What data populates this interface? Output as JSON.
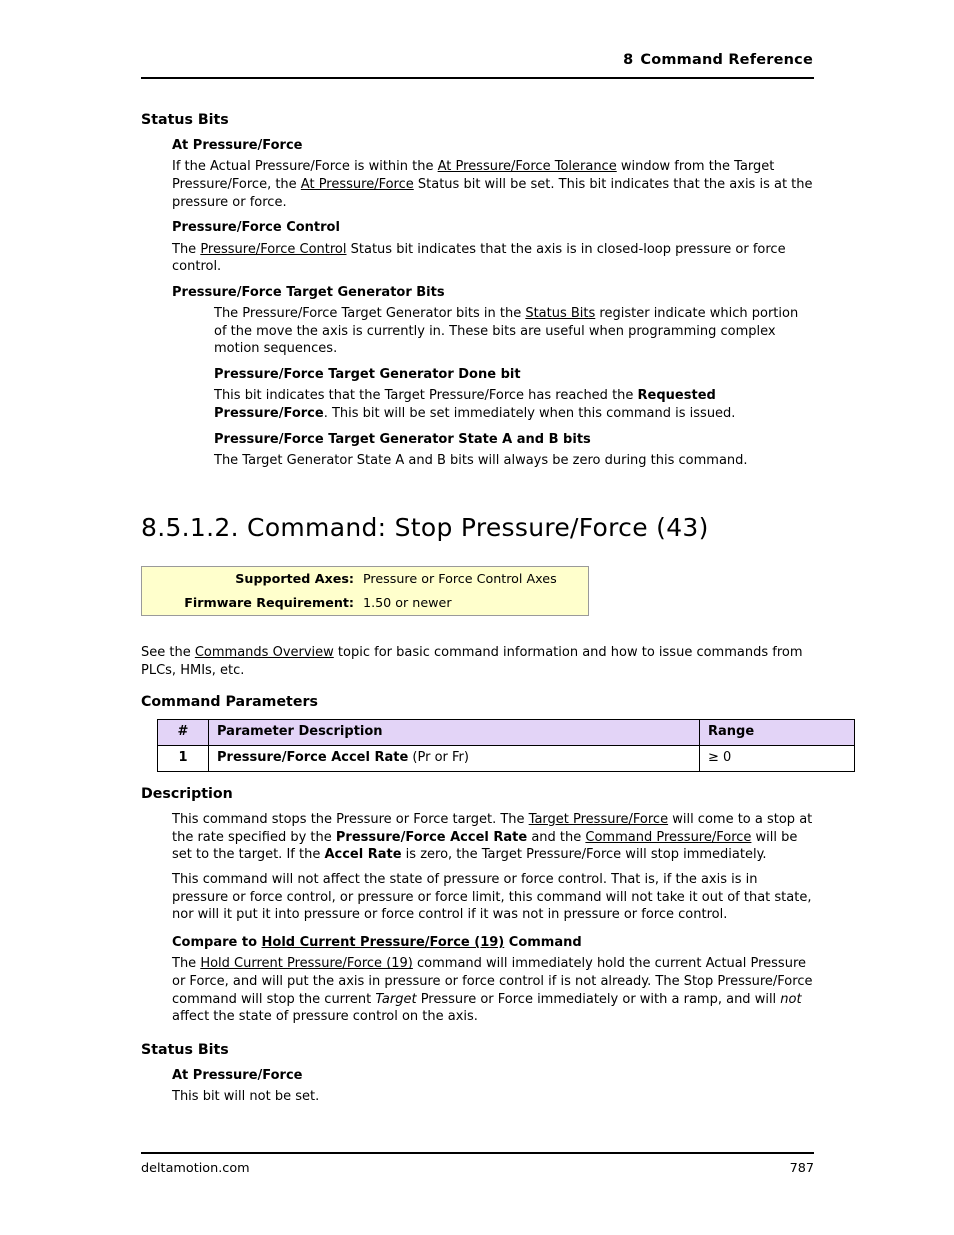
{
  "header": {
    "chapter_number": "8",
    "chapter_title": "Command Reference"
  },
  "section_status_bits_top": {
    "heading": "Status Bits",
    "items": [
      {
        "title": "At Pressure/Force",
        "paragraph_parts": [
          {
            "text": "If the Actual Pressure/Force is within the ",
            "style": "normal"
          },
          {
            "text": "At Pressure/Force Tolerance",
            "style": "link"
          },
          {
            "text": " window from the Target Pressure/Force, the ",
            "style": "normal"
          },
          {
            "text": "At Pressure/Force",
            "style": "link"
          },
          {
            "text": " Status bit will be set. This bit indicates that the axis is at the pressure or force.",
            "style": "normal"
          }
        ]
      },
      {
        "title": "Pressure/Force Control",
        "paragraph_parts": [
          {
            "text": "The ",
            "style": "normal"
          },
          {
            "text": "Pressure/Force Control",
            "style": "link"
          },
          {
            "text": " Status bit indicates that the axis is in closed-loop pressure or force control.",
            "style": "normal"
          }
        ]
      },
      {
        "title": "Pressure/Force Target Generator Bits",
        "paragraph_parts": [
          {
            "text": "The Pressure/Force Target Generator bits in the ",
            "style": "normal"
          },
          {
            "text": "Status Bits",
            "style": "link"
          },
          {
            "text": " register indicate which portion of the move the axis is currently in. These bits are useful when programming complex motion sequences.",
            "style": "normal"
          }
        ],
        "subitems": [
          {
            "title": "Pressure/Force Target Generator Done bit",
            "paragraph_parts": [
              {
                "text": "This bit indicates that the Target Pressure/Force has reached the ",
                "style": "normal"
              },
              {
                "text": "Requested Pressure/Force",
                "style": "bold"
              },
              {
                "text": ". This bit will be set immediately when this command is issued.",
                "style": "normal"
              }
            ]
          },
          {
            "title": "Pressure/Force Target Generator State A and B bits",
            "paragraph_parts": [
              {
                "text": "The Target Generator State A and B bits will always be zero during this command.",
                "style": "normal"
              }
            ]
          }
        ]
      }
    ]
  },
  "command_title": "8.5.1.2. Command: Stop Pressure/Force (43)",
  "info_box": {
    "rows": [
      {
        "label": "Supported Axes:",
        "value": "Pressure or Force Control Axes"
      },
      {
        "label": "Firmware Requirement:",
        "value": "1.50 or newer"
      }
    ],
    "background_color": "#ffffcc",
    "border_color": "#9a9a9a"
  },
  "see_also": {
    "parts": [
      {
        "text": "See the ",
        "style": "normal"
      },
      {
        "text": "Commands Overview",
        "style": "link"
      },
      {
        "text": " topic for basic command information and how to issue commands from PLCs, HMIs, etc.",
        "style": "normal"
      }
    ]
  },
  "command_parameters": {
    "heading": "Command Parameters",
    "header_background": "#e3d4f7",
    "columns": [
      "#",
      "Parameter Description",
      "Range"
    ],
    "rows": [
      {
        "num": "1",
        "description_bold": "Pressure/Force Accel Rate",
        "description_normal": " (Pr or Fr)",
        "range": "≥ 0"
      }
    ]
  },
  "description": {
    "heading": "Description",
    "paragraphs": [
      {
        "parts": [
          {
            "text": "This command stops the Pressure or Force target. The ",
            "style": "normal"
          },
          {
            "text": "Target Pressure/Force",
            "style": "link"
          },
          {
            "text": " will come to a stop at the rate specified by the ",
            "style": "normal"
          },
          {
            "text": "Pressure/Force Accel Rate",
            "style": "bold"
          },
          {
            "text": " and the ",
            "style": "normal"
          },
          {
            "text": "Command Pressure/Force",
            "style": "link"
          },
          {
            "text": " will be set to the target. If the ",
            "style": "normal"
          },
          {
            "text": "Accel Rate",
            "style": "bold"
          },
          {
            "text": " is zero, the Target Pressure/Force will stop immediately.",
            "style": "normal"
          }
        ]
      },
      {
        "parts": [
          {
            "text": "This command will not affect the state of pressure or force control. That is, if the axis is in pressure or force control, or pressure or force limit, this command will not take it out of that state, nor will it put it into pressure or force control if it was not in pressure or force control.",
            "style": "normal"
          }
        ]
      }
    ],
    "compare_heading_parts": [
      {
        "text": "Compare to ",
        "style": "bold"
      },
      {
        "text": "Hold Current Pressure/Force (19)",
        "style": "bold-link"
      },
      {
        "text": " Command",
        "style": "bold"
      }
    ],
    "compare_paragraph_parts": [
      {
        "text": "The ",
        "style": "normal"
      },
      {
        "text": "Hold Current Pressure/Force (19)",
        "style": "link"
      },
      {
        "text": " command will immediately hold the current Actual Pressure or Force, and will put the axis in pressure or force control if is not already. The Stop Pressure/Force command will stop the current ",
        "style": "normal"
      },
      {
        "text": "Target",
        "style": "italic"
      },
      {
        "text": " Pressure or Force immediately or with a ramp, and will ",
        "style": "normal"
      },
      {
        "text": "not",
        "style": "italic"
      },
      {
        "text": " affect the state of pressure control on the axis.",
        "style": "normal"
      }
    ]
  },
  "section_status_bits_bottom": {
    "heading": "Status Bits",
    "items": [
      {
        "title": "At Pressure/Force",
        "paragraph_parts": [
          {
            "text": "This bit will not be set.",
            "style": "normal"
          }
        ]
      }
    ]
  },
  "footer": {
    "site": "deltamotion.com",
    "page_number": "787"
  }
}
